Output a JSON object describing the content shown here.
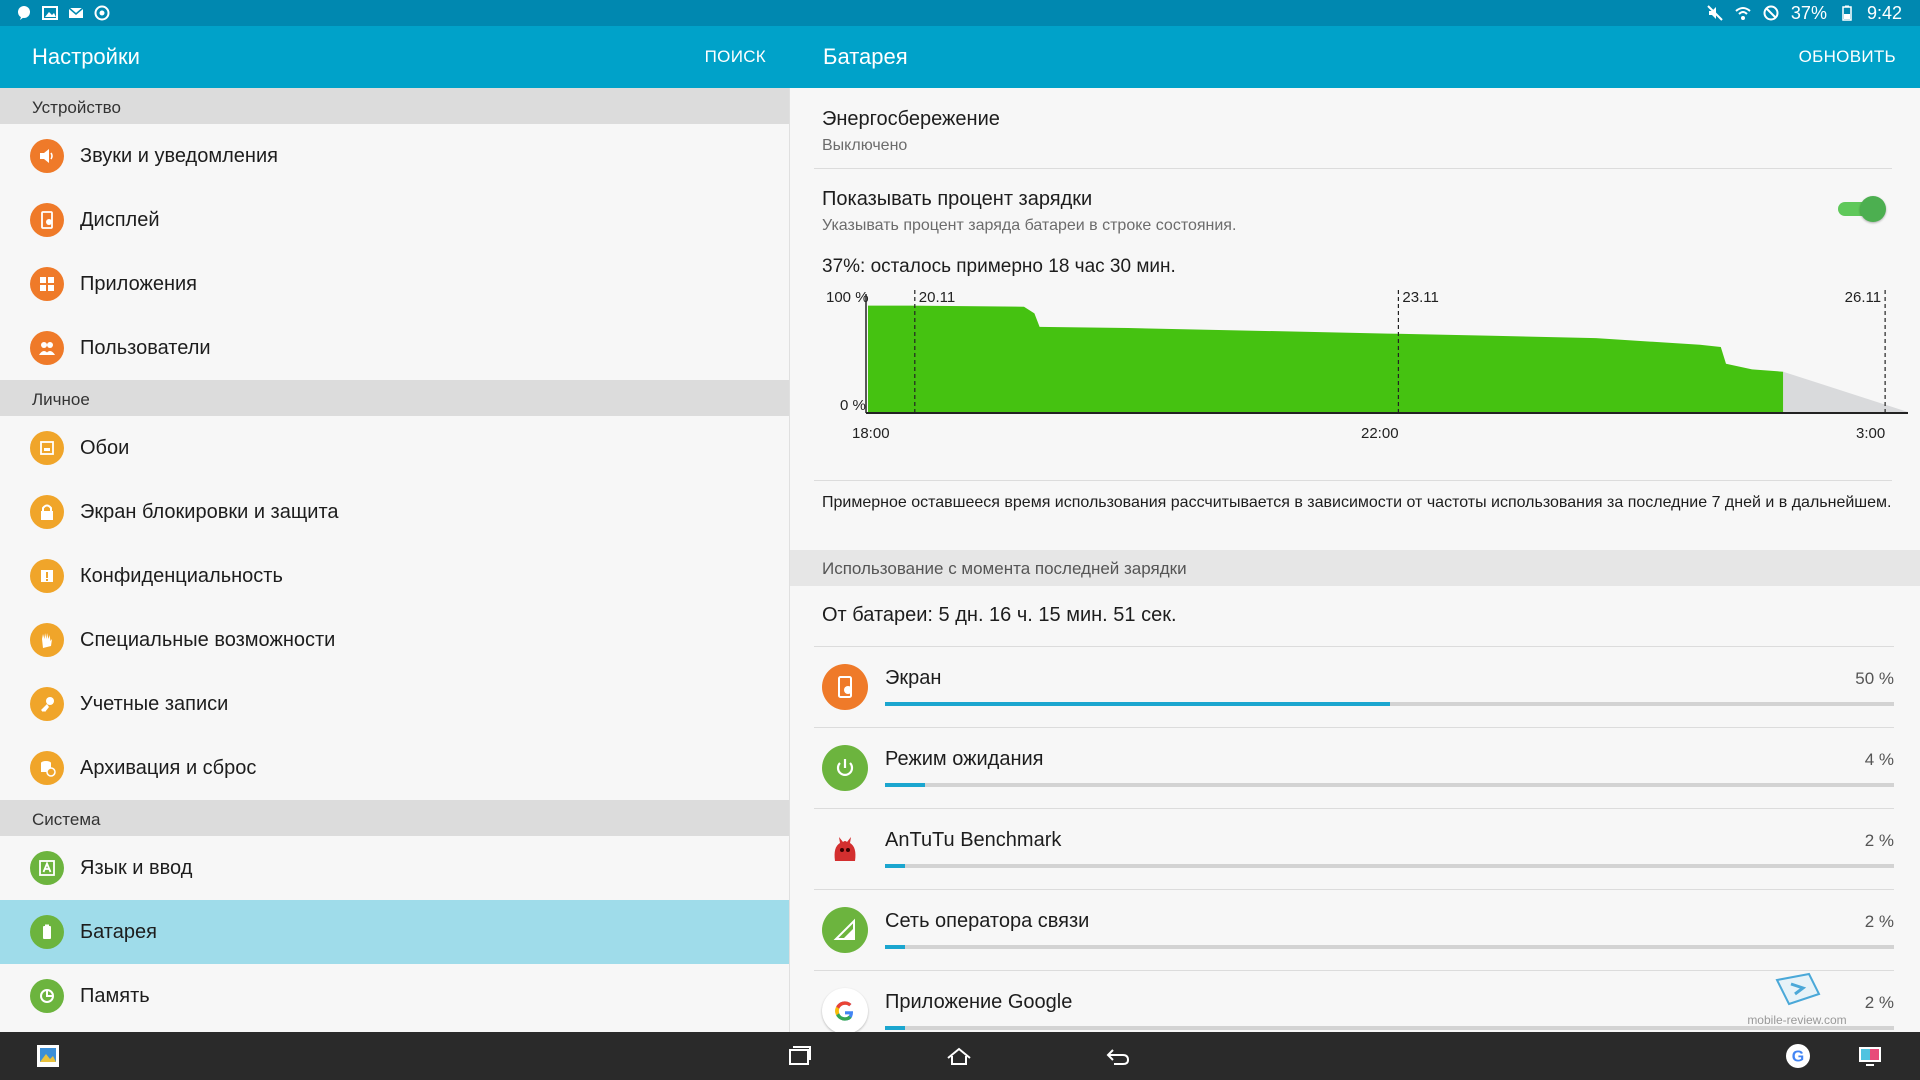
{
  "status_bar": {
    "battery_percent": "37%",
    "time": "9:42"
  },
  "left_appbar": {
    "title": "Настройки",
    "search": "ПОИСК"
  },
  "right_appbar": {
    "title": "Батарея",
    "refresh": "ОБНОВИТЬ"
  },
  "sidebar": {
    "sections": [
      {
        "header": "Устройство",
        "items": [
          {
            "label": "Звуки и уведомления",
            "icon": "volume-icon",
            "color": "#ef7a29"
          },
          {
            "label": "Дисплей",
            "icon": "display-icon",
            "color": "#ef7a29"
          },
          {
            "label": "Приложения",
            "icon": "apps-icon",
            "color": "#ef7a29"
          },
          {
            "label": "Пользователи",
            "icon": "users-icon",
            "color": "#ef7a29"
          }
        ]
      },
      {
        "header": "Личное",
        "items": [
          {
            "label": "Обои",
            "icon": "wallpaper-icon",
            "color": "#f0a52a"
          },
          {
            "label": "Экран блокировки и защита",
            "icon": "lock-icon",
            "color": "#f0a52a"
          },
          {
            "label": "Конфиденциальность",
            "icon": "privacy-icon",
            "color": "#f0a52a"
          },
          {
            "label": "Специальные возможности",
            "icon": "hand-icon",
            "color": "#f0a52a"
          },
          {
            "label": "Учетные записи",
            "icon": "key-icon",
            "color": "#f0a52a"
          },
          {
            "label": "Архивация и сброс",
            "icon": "backup-icon",
            "color": "#f0a52a"
          }
        ]
      },
      {
        "header": "Система",
        "items": [
          {
            "label": "Язык и ввод",
            "icon": "language-icon",
            "color": "#6cb43e"
          },
          {
            "label": "Батарея",
            "icon": "battery-icon",
            "color": "#6cb43e",
            "active": true
          },
          {
            "label": "Память",
            "icon": "memory-icon",
            "color": "#6cb43e"
          }
        ]
      }
    ]
  },
  "power_saving": {
    "title": "Энергосбережение",
    "state": "Выключено"
  },
  "show_percent": {
    "title": "Показывать процент зарядки",
    "subtitle": "Указывать процент заряда батареи в строке состояния.",
    "enabled": true
  },
  "remaining_text": "37%: осталось примерно 18 час 30 мин.",
  "chart_data": {
    "type": "area",
    "y_tick_labels": [
      "100 %",
      "0 %"
    ],
    "ylim": [
      0,
      100
    ],
    "x_tick_labels": [
      "18:00",
      "22:00",
      "3:00"
    ],
    "date_markers": [
      "20.11",
      "23.11",
      "26.11"
    ],
    "series": [
      {
        "kind": "actual",
        "color": "#45c211",
        "points": [
          [
            0,
            95
          ],
          [
            0.04,
            95
          ],
          [
            0.15,
            94
          ],
          [
            0.16,
            88
          ],
          [
            0.165,
            76
          ],
          [
            0.25,
            75
          ],
          [
            0.5,
            70
          ],
          [
            0.6,
            68
          ],
          [
            0.7,
            66
          ],
          [
            0.8,
            60
          ],
          [
            0.82,
            58
          ],
          [
            0.825,
            43
          ],
          [
            0.85,
            38
          ],
          [
            0.88,
            36
          ]
        ]
      },
      {
        "kind": "projected",
        "color": "#d9dadc",
        "points": [
          [
            0.88,
            36
          ],
          [
            1.0,
            0
          ]
        ]
      }
    ],
    "date_marker_positions": [
      0.045,
      0.51,
      0.978
    ]
  },
  "estimate_note": "Примерное оставшееся время использования рассчитывается в зависимости от частоты использования за последние 7 дней и в дальнейшем.",
  "usage_header": "Использование с момента последней зарядки",
  "from_battery": "От батареи: 5 дн. 16 ч. 15 мин. 51 сек.",
  "usage": [
    {
      "name": "Экран",
      "percent": "50 %",
      "value": 50,
      "icon": "screen-icon",
      "color": "#ef7a29"
    },
    {
      "name": "Режим ожидания",
      "percent": "4 %",
      "value": 4,
      "icon": "power-icon",
      "color": "#6cb43e"
    },
    {
      "name": "AnTuTu Benchmark",
      "percent": "2 %",
      "value": 2,
      "icon": "antutu-icon",
      "color": "#d32f2f"
    },
    {
      "name": "Сеть оператора связи",
      "percent": "2 %",
      "value": 2,
      "icon": "signal-icon",
      "color": "#6cb43e"
    },
    {
      "name": "Приложение Google",
      "percent": "2 %",
      "value": 2,
      "icon": "google-icon",
      "color": "#ffffff"
    }
  ],
  "watermark": "mobile-review.com",
  "colors": {
    "status_bar": "#0088b0",
    "app_bar": "#00a2c9",
    "active_row": "#9fdcea",
    "progress": "#1ba6cf"
  }
}
